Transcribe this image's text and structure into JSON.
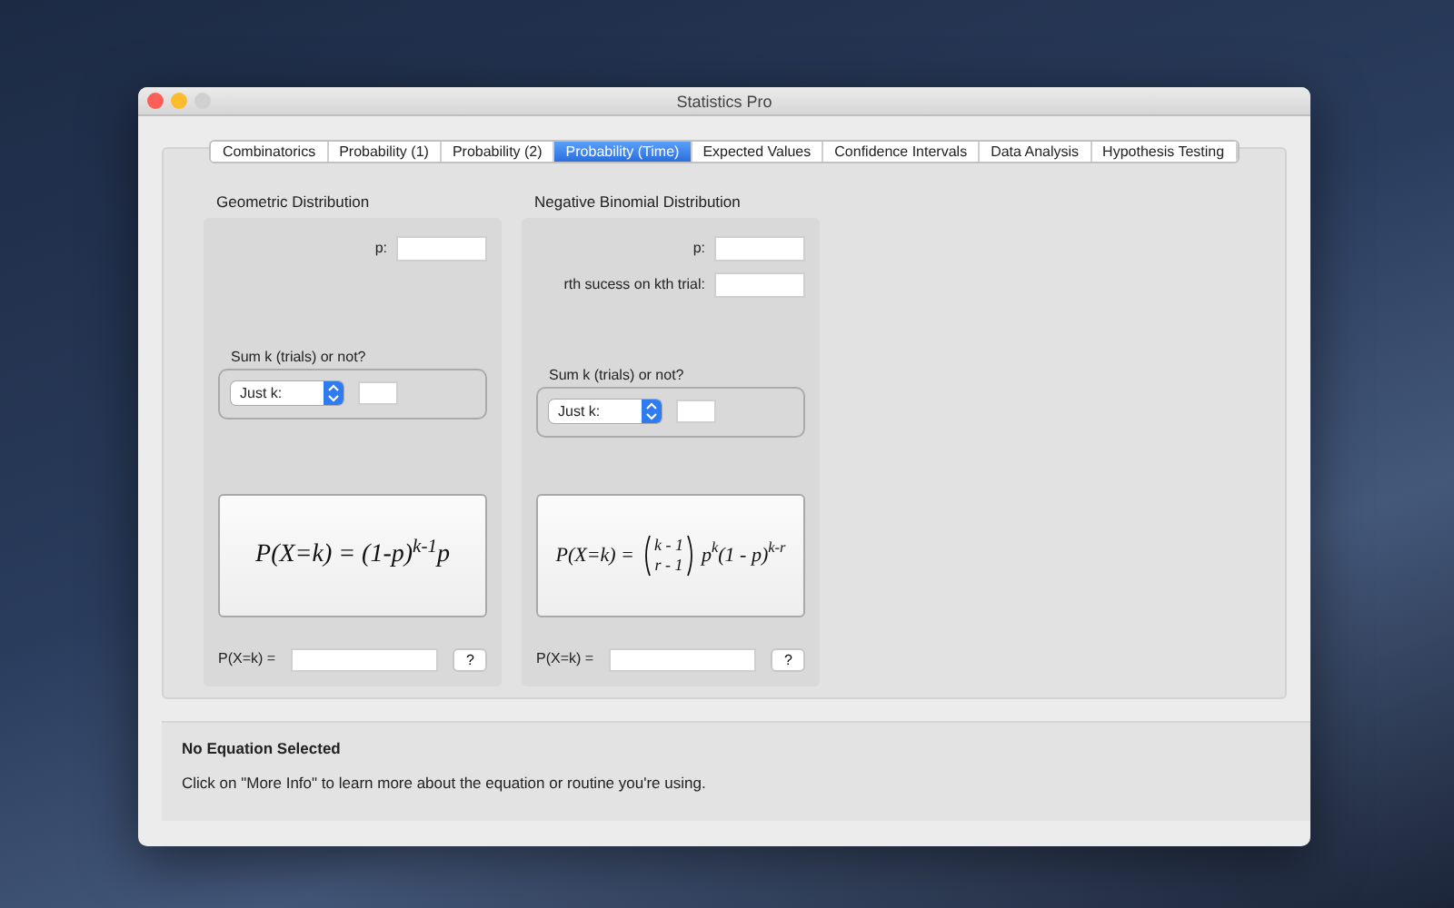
{
  "window": {
    "title": "Statistics Pro"
  },
  "tabs": [
    {
      "label": "Combinatorics",
      "selected": false
    },
    {
      "label": "Probability (1)",
      "selected": false
    },
    {
      "label": "Probability (2)",
      "selected": false
    },
    {
      "label": "Probability (Time)",
      "selected": true
    },
    {
      "label": "Expected Values",
      "selected": false
    },
    {
      "label": "Confidence Intervals",
      "selected": false
    },
    {
      "label": "Data Analysis",
      "selected": false
    },
    {
      "label": "Hypothesis Testing",
      "selected": false
    }
  ],
  "panels": [
    {
      "title": "Geometric Distribution",
      "fields": [
        {
          "label": "p:"
        }
      ],
      "sum_group": {
        "title": "Sum k (trials) or not?",
        "select": "Just k:"
      },
      "formula": {
        "kind": "simple",
        "text": "P(X=k) = (1-p)$^{k-1}$p"
      },
      "result": {
        "label": "P(X=k) =",
        "button": "?"
      }
    },
    {
      "title": "Negative Binomial Distribution",
      "fields": [
        {
          "label": "p:"
        },
        {
          "label": "rth sucess on kth trial:"
        }
      ],
      "sum_group": {
        "title": "Sum k (trials) or not?",
        "select": "Just k:"
      },
      "formula": {
        "kind": "binomial",
        "lhs": "P(X=k) =",
        "top": "k - 1",
        "bottom": "r - 1",
        "rest": "p$^{k}$(1 - p)$^{k-r}$"
      },
      "result": {
        "label": "P(X=k) =",
        "button": "?"
      }
    }
  ],
  "info": {
    "title": "No Equation Selected",
    "text": "Click on \"More Info\" to learn more about the equation or routine you're using."
  }
}
